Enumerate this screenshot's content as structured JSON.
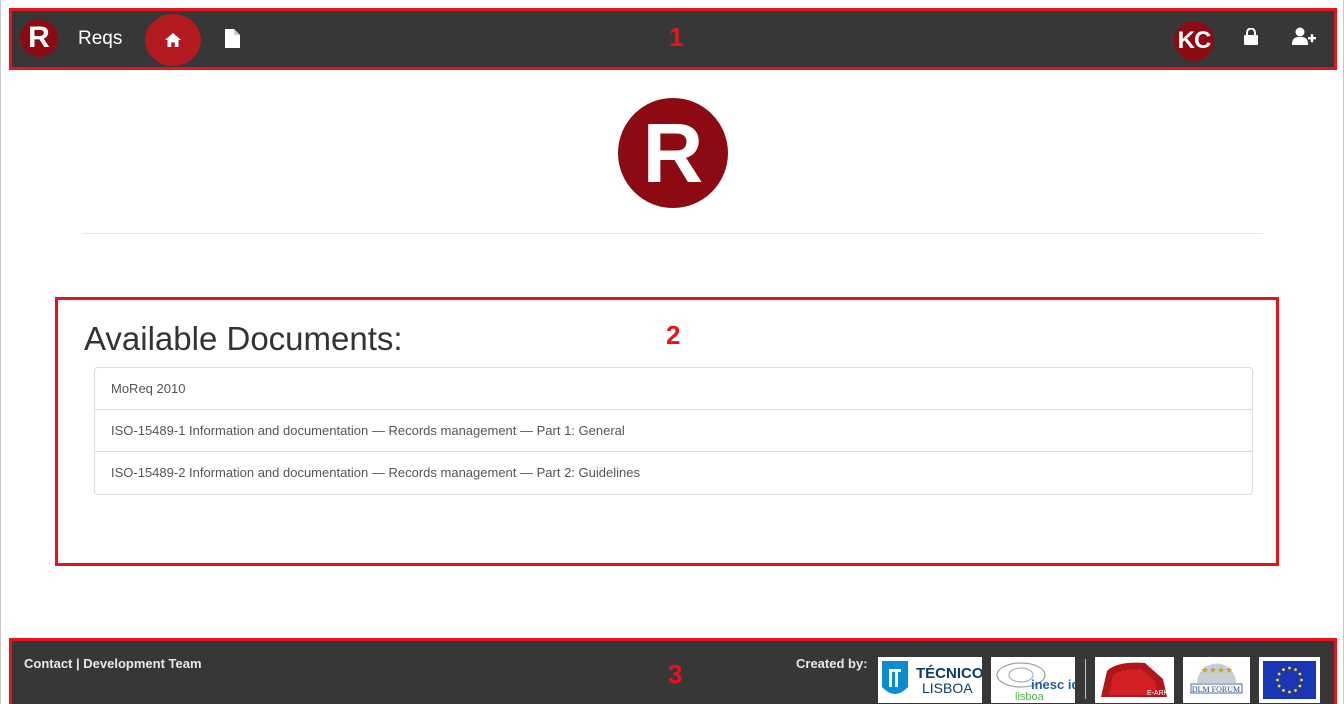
{
  "app": {
    "brand_letter": "R",
    "brand_name": "Reqs"
  },
  "navbar": {
    "region_number": "1",
    "user_initials": "KC",
    "icons": {
      "home": "home-icon",
      "documents": "file-icon",
      "lock": "lock-icon",
      "add_user": "user-plus-icon"
    }
  },
  "hero": {
    "logo_letter": "R"
  },
  "documents": {
    "region_number": "2",
    "title": "Available Documents:",
    "items": [
      {
        "label": "MoReq 2010"
      },
      {
        "label": "ISO-15489-1 Information and documentation — Records management — Part 1: General"
      },
      {
        "label": "ISO-15489-2 Information and documentation — Records management — Part 2: Guidelines"
      }
    ]
  },
  "footer": {
    "region_number": "3",
    "contact": "Contact",
    "divider": "|",
    "dev_team": "Development Team",
    "created_by": "Created by:",
    "partners": {
      "tecnico_line1": "TÉCNICO",
      "tecnico_line2": "LISBOA",
      "inesc_line1": "inesc id",
      "inesc_line2": "lisboa",
      "earchiving": "E-ARK",
      "dlm": "DLM FORUM"
    }
  },
  "colors": {
    "accent": "#8c0b13",
    "nav_bg": "#373737",
    "highlight": "#e8141b",
    "home_active": "#b31a20"
  }
}
